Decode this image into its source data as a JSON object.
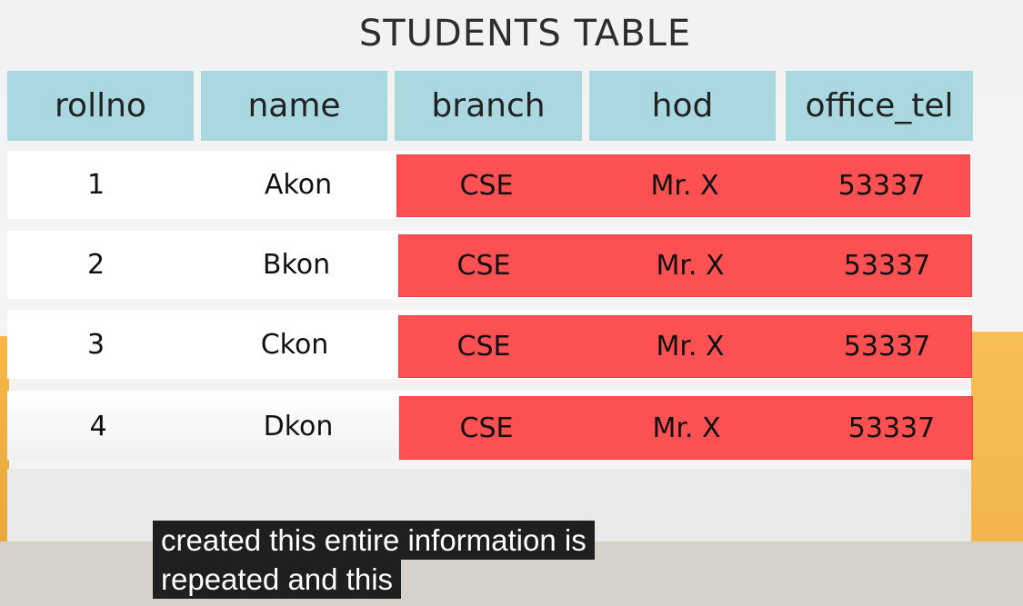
{
  "title": "STUDENTS TABLE",
  "headers": [
    "rollno",
    "name",
    "branch",
    "hod",
    "office_tel"
  ],
  "rows": [
    {
      "rollno": "1",
      "name": "Akon",
      "branch": "CSE",
      "hod": "Mr. X",
      "office_tel": "53337"
    },
    {
      "rollno": "2",
      "name": "Bkon",
      "branch": "CSE",
      "hod": "Mr. X",
      "office_tel": "53337"
    },
    {
      "rollno": "3",
      "name": "Ckon",
      "branch": "CSE",
      "hod": "Mr. X",
      "office_tel": "53337"
    },
    {
      "rollno": "4",
      "name": "Dkon",
      "branch": "CSE",
      "hod": "Mr. X",
      "office_tel": "53337"
    }
  ],
  "highlight_color": "#fd5052",
  "header_color": "#a9d8e1",
  "captions": [
    "created this entire information is",
    "repeated and this"
  ]
}
